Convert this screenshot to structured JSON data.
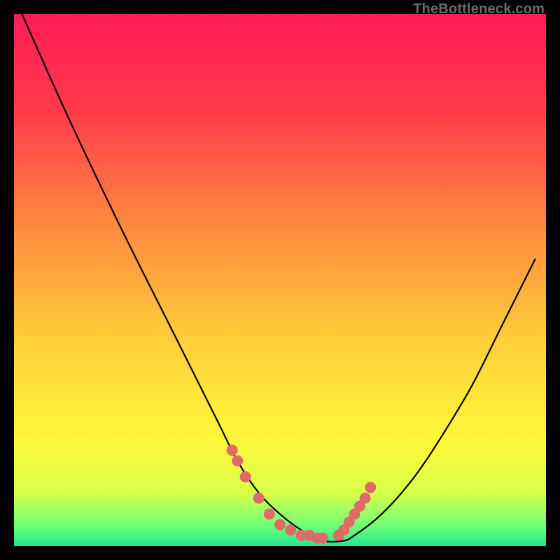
{
  "watermark": {
    "text": "TheBottleneck.com"
  },
  "chart_data": {
    "type": "line",
    "title": "",
    "xlabel": "",
    "ylabel": "",
    "xlim": [
      0,
      100
    ],
    "ylim": [
      0,
      100
    ],
    "grid": false,
    "legend": null,
    "bottleneck_curve": {
      "x": [
        1.5,
        10,
        20,
        30,
        38,
        42,
        46,
        50,
        54,
        58,
        62,
        64,
        68,
        72,
        76,
        80,
        86,
        92,
        98
      ],
      "y": [
        100,
        81,
        60,
        40,
        24,
        16,
        10,
        6,
        3,
        1,
        1,
        2,
        5,
        9,
        14,
        20,
        30,
        42,
        54
      ]
    },
    "marker_cluster": {
      "comment": "salmon/pink dot markers near the valley of the curve",
      "x": [
        41,
        42,
        43.5,
        46,
        48,
        50,
        52,
        54,
        55.5,
        57,
        58,
        61,
        62,
        63,
        64,
        65,
        66,
        67
      ],
      "y": [
        18,
        16,
        13,
        9,
        6,
        4,
        3,
        2,
        2,
        1.5,
        1.5,
        2,
        3,
        4.5,
        6,
        7.5,
        9,
        11
      ]
    },
    "background_gradient_stops": [
      {
        "offset": 0.0,
        "color": "#ff1c55"
      },
      {
        "offset": 0.18,
        "color": "#ff3a4b"
      },
      {
        "offset": 0.4,
        "color": "#ff8a3f"
      },
      {
        "offset": 0.62,
        "color": "#ffd03a"
      },
      {
        "offset": 0.8,
        "color": "#fff73a"
      },
      {
        "offset": 0.9,
        "color": "#d8ff47"
      },
      {
        "offset": 0.965,
        "color": "#6aff7a"
      },
      {
        "offset": 1.0,
        "color": "#23e58e"
      }
    ],
    "marker_color": "#e06a6a",
    "curve_color": "#000000"
  }
}
